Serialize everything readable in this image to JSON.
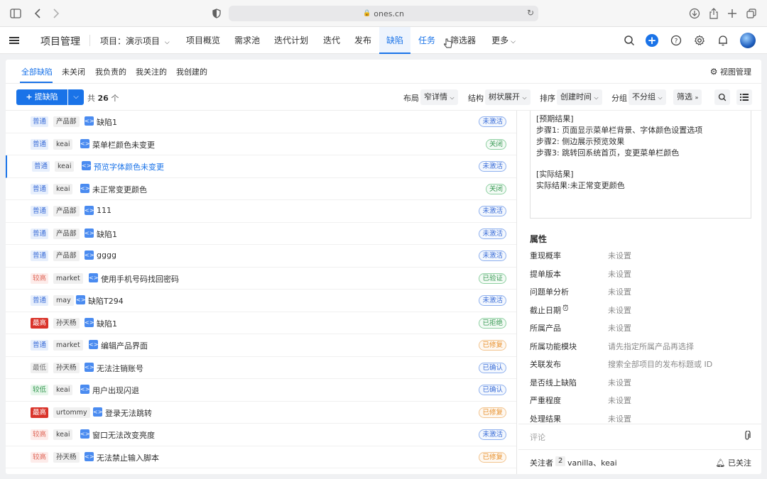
{
  "browser": {
    "url": "ones.cn"
  },
  "header": {
    "app_title": "项目管理",
    "project_label": "项目：演示项目",
    "nav": [
      "项目概览",
      "需求池",
      "迭代计划",
      "迭代",
      "发布",
      "缺陷",
      "任务",
      "筛选器",
      "更多"
    ],
    "active_nav": "缺陷"
  },
  "subtabs": [
    "全部缺陷",
    "未关闭",
    "我负责的",
    "我关注的",
    "我创建的"
  ],
  "view_mgmt": "视图管理",
  "toolbar": {
    "create_label": "提缺陷",
    "count_prefix": "共",
    "count": "26",
    "count_suffix": "个",
    "layout_label": "布局",
    "layout_value": "窄详情",
    "structure_label": "结构",
    "structure_value": "树状展开",
    "sort_label": "排序",
    "sort_value": "创建时间",
    "group_label": "分组",
    "group_value": "不分组",
    "filter_label": "筛选"
  },
  "rows": [
    {
      "priority": "普通",
      "pclass": "normal",
      "owner": "产品部",
      "title": "缺陷1",
      "status": "未激活",
      "sclass": "st-blue"
    },
    {
      "priority": "普通",
      "pclass": "normal",
      "owner": "keai",
      "title": "菜单栏颜色未变更",
      "status": "关闭",
      "sclass": "st-green"
    },
    {
      "priority": "普通",
      "pclass": "normal",
      "owner": "keai",
      "title": "预览字体颜色未变更",
      "status": "未激活",
      "sclass": "st-blue",
      "selected": true
    },
    {
      "priority": "普通",
      "pclass": "normal",
      "owner": "keai",
      "title": "未正常变更颜色",
      "status": "关闭",
      "sclass": "st-green"
    },
    {
      "priority": "普通",
      "pclass": "normal",
      "owner": "产品部",
      "title": "111",
      "status": "未激活",
      "sclass": "st-blue"
    },
    {
      "priority": "普通",
      "pclass": "normal",
      "owner": "产品部",
      "title": "缺陷1",
      "status": "未激活",
      "sclass": "st-blue"
    },
    {
      "priority": "普通",
      "pclass": "normal",
      "owner": "产品部",
      "title": "gggg",
      "status": "未激活",
      "sclass": "st-blue"
    },
    {
      "priority": "较高",
      "pclass": "high",
      "owner": "market",
      "title": "使用手机号码找回密码",
      "status": "已验证",
      "sclass": "st-green"
    },
    {
      "priority": "普通",
      "pclass": "normal",
      "owner": "may",
      "title": "缺陷T294",
      "status": "未激活",
      "sclass": "st-blue"
    },
    {
      "priority": "最高",
      "pclass": "highest",
      "owner": "孙天杨",
      "title": "缺陷1",
      "status": "已拒绝",
      "sclass": "st-green"
    },
    {
      "priority": "普通",
      "pclass": "normal",
      "owner": "market",
      "title": "编辑产品界面",
      "status": "已修复",
      "sclass": "st-orange"
    },
    {
      "priority": "最低",
      "pclass": "lowest",
      "owner": "孙天杨",
      "title": "无法注销账号",
      "status": "已确认",
      "sclass": "st-blue"
    },
    {
      "priority": "较低",
      "pclass": "low",
      "owner": "keai",
      "title": "用户出现闪退",
      "status": "已确认",
      "sclass": "st-blue"
    },
    {
      "priority": "最高",
      "pclass": "highest",
      "owner": "urtommy",
      "title": "登录无法跳转",
      "status": "已修复",
      "sclass": "st-orange"
    },
    {
      "priority": "较高",
      "pclass": "high",
      "owner": "keai",
      "title": "窗口无法改变亮度",
      "status": "未激活",
      "sclass": "st-blue"
    },
    {
      "priority": "较高",
      "pclass": "high",
      "owner": "孙天杨",
      "title": "无法禁止输入脚本",
      "status": "已修复",
      "sclass": "st-orange"
    }
  ],
  "detail": {
    "desc_lines": [
      "[预期结果]",
      "步骤1: 页面显示菜单栏背景、字体颜色设置选项",
      "步骤2: 侧边展示预览效果",
      "步骤3: 跳转回系统首页，变更菜单栏颜色",
      "",
      "[实际结果]",
      "实际结果:未正常变更颜色"
    ],
    "props_title": "属性",
    "props": [
      {
        "label": "重现概率",
        "value": "未设置"
      },
      {
        "label": "提单版本",
        "value": "未设置"
      },
      {
        "label": "问题单分析",
        "value": "未设置"
      },
      {
        "label": "截止日期",
        "value": "未设置"
      },
      {
        "label": "所属产品",
        "value": "未设置"
      },
      {
        "label": "所属功能模块",
        "value": "请先指定所属产品再选择"
      },
      {
        "label": "关联发布",
        "value": "搜索全部项目的发布标题或 ID"
      },
      {
        "label": "是否线上缺陷",
        "value": "未设置"
      },
      {
        "label": "严重程度",
        "value": "未设置"
      },
      {
        "label": "处理结果",
        "value": "未设置"
      }
    ],
    "comment_label": "评论",
    "watchers_label": "关注者",
    "watchers_count": "2",
    "watchers_names": "vanilla、keai",
    "watch_button": "已关注"
  },
  "colors": {
    "accent": "#1a73e8",
    "danger": "#d9342b"
  }
}
